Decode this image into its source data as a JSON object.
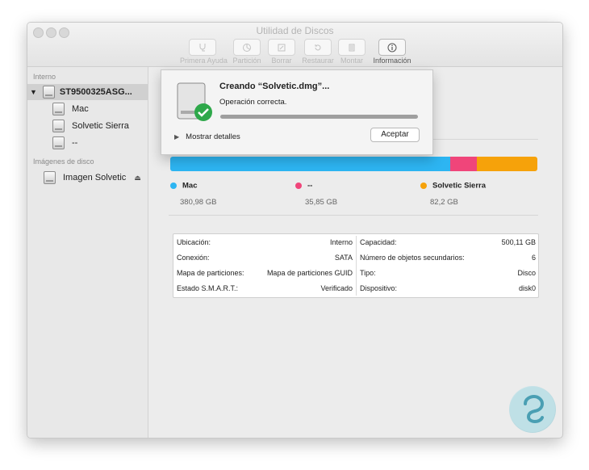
{
  "window": {
    "title": "Utilidad de Discos"
  },
  "toolbar": {
    "items": [
      {
        "label": "Primera Ayuda",
        "icon": "stethoscope-icon"
      },
      {
        "label": "Partición",
        "icon": "pie-chart-icon"
      },
      {
        "label": "Borrar",
        "icon": "eraser-icon"
      },
      {
        "label": "Restaurar",
        "icon": "restore-icon"
      },
      {
        "label": "Montar",
        "icon": "mount-icon"
      },
      {
        "label": "Información",
        "icon": "info-icon"
      }
    ]
  },
  "sidebar": {
    "section_internal": "Interno",
    "disk_name": "ST9500325ASG...",
    "volumes": [
      "Mac",
      "Solvetic Sierra",
      "--"
    ],
    "section_images": "Imágenes de disco",
    "image_name": "Imagen Solvetic"
  },
  "sheet": {
    "title": "Creando “Solvetic.dmg”...",
    "status": "Operación correcta.",
    "progress": 1.0,
    "details_label": "Mostrar detalles",
    "accept_label": "Aceptar"
  },
  "usage": {
    "segments": [
      {
        "name": "Mac",
        "size": "380,98 GB",
        "color": "#2db5f2",
        "value": 380.98
      },
      {
        "name": "--",
        "size": "35,85 GB",
        "color": "#f0457a",
        "value": 35.85
      },
      {
        "name": "Solvetic Sierra",
        "size": "82,2 GB",
        "color": "#f6a20a",
        "value": 82.2
      }
    ]
  },
  "info": {
    "left": [
      {
        "label": "Ubicación:",
        "value": "Interno"
      },
      {
        "label": "Conexión:",
        "value": "SATA"
      },
      {
        "label": "Mapa de particiones:",
        "value": "Mapa de particiones GUID"
      },
      {
        "label": "Estado S.M.A.R.T.:",
        "value": "Verificado"
      }
    ],
    "right": [
      {
        "label": "Capacidad:",
        "value": "500,11 GB"
      },
      {
        "label": "Número de objetos secundarios:",
        "value": "6"
      },
      {
        "label": "Tipo:",
        "value": "Disco"
      },
      {
        "label": "Dispositivo:",
        "value": "disk0"
      }
    ]
  }
}
